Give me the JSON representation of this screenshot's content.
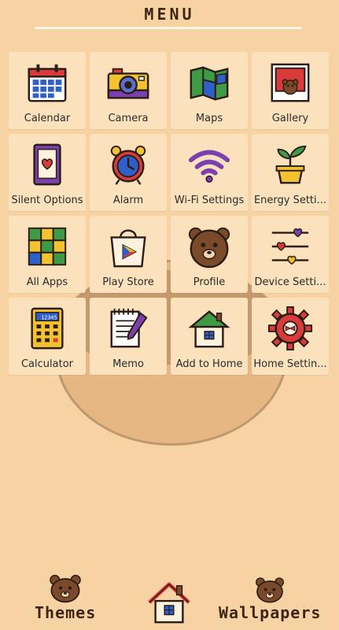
{
  "header": {
    "title": "MENU"
  },
  "apps": [
    {
      "label": "Calendar",
      "icon": "calendar-icon"
    },
    {
      "label": "Camera",
      "icon": "camera-icon"
    },
    {
      "label": "Maps",
      "icon": "map-icon"
    },
    {
      "label": "Gallery",
      "icon": "gallery-icon"
    },
    {
      "label": "Silent Options",
      "icon": "tablet-heart-icon"
    },
    {
      "label": "Alarm",
      "icon": "alarm-clock-icon"
    },
    {
      "label": "Wi-Fi Settings",
      "icon": "wifi-icon"
    },
    {
      "label": "Energy Setti...",
      "icon": "plant-icon"
    },
    {
      "label": "All Apps",
      "icon": "grid-icon"
    },
    {
      "label": "Play Store",
      "icon": "shopping-bag-icon"
    },
    {
      "label": "Profile",
      "icon": "bear-donut-icon"
    },
    {
      "label": "Device Setti...",
      "icon": "sliders-icon"
    },
    {
      "label": "Calculator",
      "icon": "calculator-icon"
    },
    {
      "label": "Memo",
      "icon": "notepad-icon"
    },
    {
      "label": "Add to Home",
      "icon": "house-icon"
    },
    {
      "label": "Home Settin...",
      "icon": "gear-icon"
    }
  ],
  "calculator_display": "12345",
  "dock": {
    "themes_label": "Themes",
    "wallpapers_label": "Wallpapers"
  }
}
